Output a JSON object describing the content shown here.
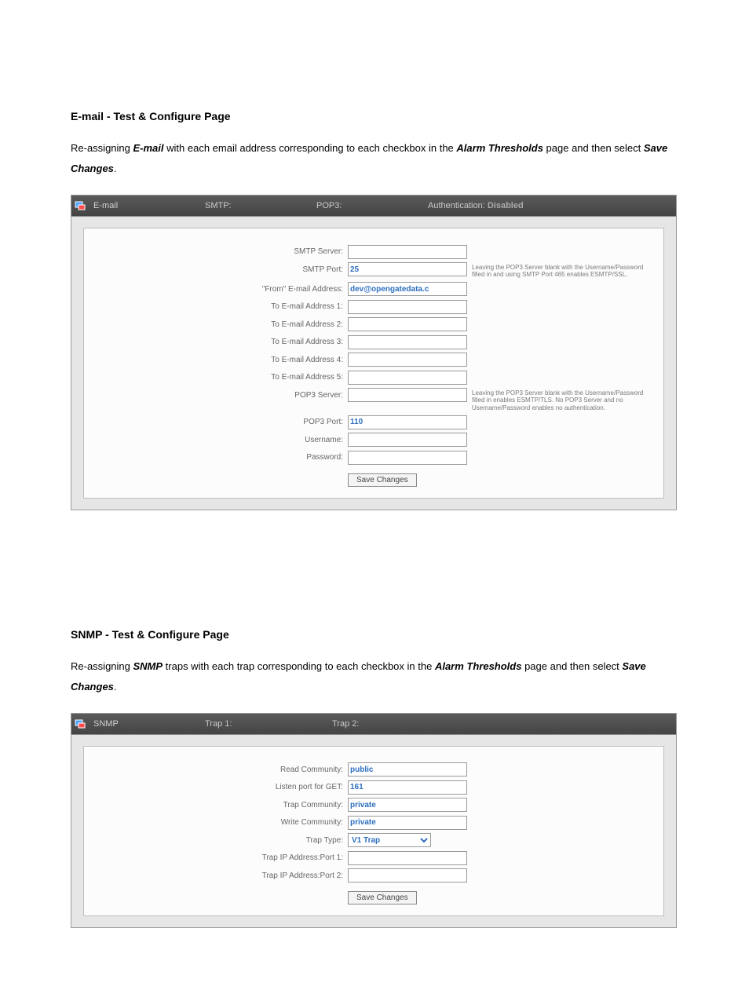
{
  "doc": {
    "section1_title": "E-mail - Test & Configure Page",
    "section1_para_a": "Re-assigning ",
    "section1_para_b": "E-mail",
    "section1_para_c": " with each email address corresponding to each checkbox in the ",
    "section1_para_d": "Alarm Thresholds",
    "section1_para_e": " page and then select ",
    "section1_para_f": "Save Changes",
    "section1_para_g": ".",
    "section2_title": "SNMP - Test & Configure Page",
    "section2_para_a": "Re-assigning ",
    "section2_para_b": "SNMP",
    "section2_para_c": " traps with each trap corresponding to each checkbox in the ",
    "section2_para_d": "Alarm Thresholds",
    "section2_para_e": " page and then select ",
    "section2_para_f": "Save Changes",
    "section2_para_g": "."
  },
  "email_panel": {
    "header": {
      "title": "E-mail",
      "smtp_label": "SMTP:",
      "smtp_value": "",
      "pop3_label": "POP3:",
      "pop3_value": "",
      "auth_label": "Authentication:",
      "auth_value": "Disabled"
    },
    "labels": {
      "smtp_server": "SMTP Server:",
      "smtp_port": "SMTP Port:",
      "from_addr": "\"From\" E-mail Address:",
      "to1": "To E-mail Address 1:",
      "to2": "To E-mail Address 2:",
      "to3": "To E-mail Address 3:",
      "to4": "To E-mail Address 4:",
      "to5": "To E-mail Address 5:",
      "pop3_server": "POP3 Server:",
      "pop3_port": "POP3 Port:",
      "username": "Username:",
      "password": "Password:"
    },
    "values": {
      "smtp_server": "",
      "smtp_port": "25",
      "from_addr": "dev@opengatedata.c",
      "to1": "",
      "to2": "",
      "to3": "",
      "to4": "",
      "to5": "",
      "pop3_server": "",
      "pop3_port": "110",
      "username": "",
      "password": ""
    },
    "help": {
      "smtp_port": "Leaving the POP3 Server blank with the Username/Password filled in and using SMTP Port 465 enables ESMTP/SSL.",
      "pop3_server": "Leaving the POP3 Server blank with the Username/Password filled in enables ESMTP/TLS. No POP3 Server and no Username/Password enables no authentication."
    },
    "save_label": "Save Changes"
  },
  "snmp_panel": {
    "header": {
      "title": "SNMP",
      "trap1_label": "Trap 1:",
      "trap1_value": "",
      "trap2_label": "Trap 2:",
      "trap2_value": ""
    },
    "labels": {
      "read_comm": "Read Community:",
      "listen_port": "Listen port for GET:",
      "trap_comm": "Trap Community:",
      "write_comm": "Write Community:",
      "trap_type": "Trap Type:",
      "trap_ip1": "Trap IP Address:Port 1:",
      "trap_ip2": "Trap IP Address:Port 2:"
    },
    "values": {
      "read_comm": "public",
      "listen_port": "161",
      "trap_comm": "private",
      "write_comm": "private",
      "trap_type": "V1 Trap",
      "trap_ip1": "",
      "trap_ip2": ""
    },
    "save_label": "Save Changes"
  }
}
